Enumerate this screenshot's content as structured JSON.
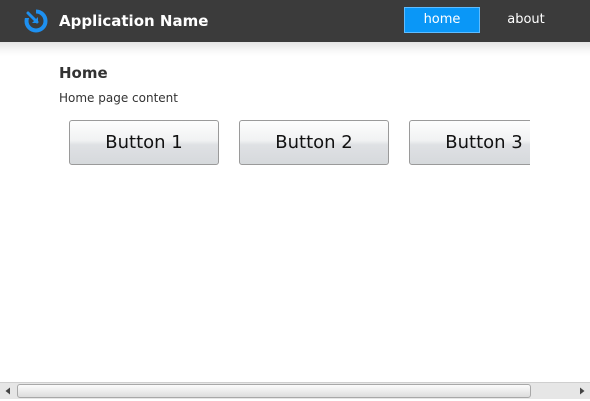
{
  "header": {
    "app_title": "Application Name",
    "logo_icon": "app-logo-icon",
    "background_color": "#3b3b3b",
    "nav": {
      "items": [
        {
          "label": "home",
          "active": true
        },
        {
          "label": "about",
          "active": false
        }
      ],
      "active_color": "#0a97f7"
    }
  },
  "main": {
    "page_title": "Home",
    "content_text": "Home page content",
    "buttons": [
      {
        "label": "Button 1"
      },
      {
        "label": "Button 2"
      },
      {
        "label": "Button 3"
      }
    ]
  },
  "scrollbar": {
    "orientation": "horizontal",
    "left_arrow_icon": "arrow-left-icon",
    "right_arrow_icon": "arrow-right-icon"
  }
}
